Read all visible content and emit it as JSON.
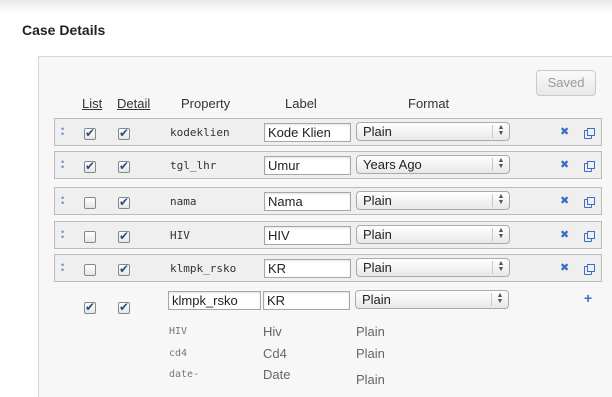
{
  "title": "Case Details",
  "saved_label": "Saved",
  "headers": {
    "list": "List",
    "detail": "Detail",
    "property": "Property",
    "label": "Label",
    "format": "Format"
  },
  "rows": [
    {
      "list": true,
      "detail": true,
      "property": "kodeklien",
      "label": "Kode Klien",
      "format": "Plain"
    },
    {
      "list": true,
      "detail": true,
      "property": "tgl_lhr",
      "label": "Umur",
      "format": "Years Ago"
    },
    {
      "list": false,
      "detail": true,
      "property": "nama",
      "label": "Nama",
      "format": "Plain"
    },
    {
      "list": false,
      "detail": true,
      "property": "HIV",
      "label": "HIV",
      "format": "Plain"
    },
    {
      "list": false,
      "detail": true,
      "property": "klmpk_rsko",
      "label": "KR",
      "format": "Plain"
    }
  ],
  "new_row": {
    "list": true,
    "detail": true,
    "property": "klmpk_rsko",
    "label": "KR",
    "format": "Plain"
  },
  "suggestions": [
    {
      "property": "HIV",
      "label": "Hiv",
      "format": "Plain"
    },
    {
      "property": "cd4",
      "label": "Cd4",
      "format": "Plain"
    },
    {
      "property": "date-",
      "label": "Date",
      "format": "Plain"
    }
  ],
  "icons": {
    "handle": "drag-handle-icon",
    "delete": "close-icon",
    "copy": "copy-icon",
    "add": "plus-icon"
  },
  "colors": {
    "accent": "#3a6fc4",
    "checkmark": "#2a4e82"
  }
}
